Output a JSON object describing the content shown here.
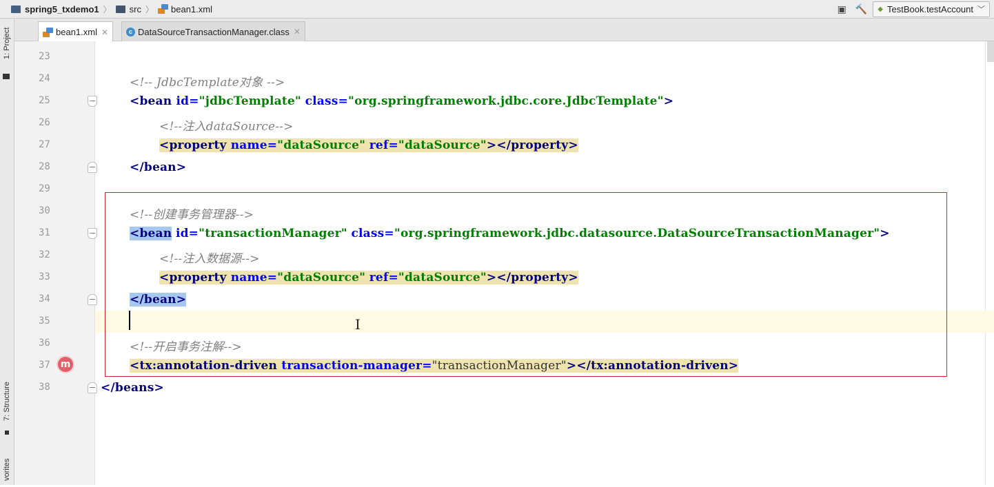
{
  "navbar": {
    "breadcrumb": [
      "spring5_txdemo1",
      "src",
      "bean1.xml"
    ],
    "run_config": "TestBook.testAccount"
  },
  "sidebar": {
    "project_tab": "1: Project",
    "structure_tab": "7: Structure",
    "favorites_tab": "vorites"
  },
  "tabs": [
    {
      "label": "bean1.xml",
      "active": true
    },
    {
      "label": "DataSourceTransactionManager.class",
      "active": false
    }
  ],
  "code": {
    "line_numbers": [
      "23",
      "24",
      "25",
      "26",
      "27",
      "28",
      "29",
      "30",
      "31",
      "32",
      "33",
      "34",
      "35",
      "36",
      "37",
      "38"
    ],
    "l24_comment": "<!-- JdbcTemplate对象 -->",
    "l25_open": "<bean ",
    "l25_attr1": "id=",
    "l25_val1": "\"jdbcTemplate\"",
    "l25_attr2": "class=",
    "l25_val2": "\"org.springframework.jdbc.core.JdbcTemplate\"",
    "l25_close": ">",
    "l26_comment": "<!--注入dataSource-->",
    "l27_open": "<property ",
    "l27_attr1": "name=",
    "l27_val1": "\"dataSource\"",
    "l27_attr2": "ref=",
    "l27_val2": "\"dataSource\"",
    "l27_close": "></property>",
    "l28_tag": "</bean>",
    "l30_comment": "<!--创建事务管理器-->",
    "l31_open": "<bean",
    "l31_attr1": "id=",
    "l31_val1": "\"transactionManager\"",
    "l31_attr2": "class=",
    "l31_val2": "\"org.springframework.jdbc.datasource.DataSourceTransactionManager\"",
    "l31_close": ">",
    "l32_comment": "<!--注入数据源-->",
    "l33_open": "<property ",
    "l33_attr1": "name=",
    "l33_val1": "\"dataSource\"",
    "l33_attr2": "ref=",
    "l33_val2": "\"dataSource\"",
    "l33_close": "></property>",
    "l34_tag": "</bean>",
    "l36_comment": "<!--开启事务注解-->",
    "l37_open": "<tx:annotation-driven ",
    "l37_attr": "transaction-manager=",
    "l37_val": "\"transactionManager\"",
    "l37_close": "></tx:annotation-driven>",
    "l38_tag": "</beans>",
    "gutter_marker": "m"
  }
}
